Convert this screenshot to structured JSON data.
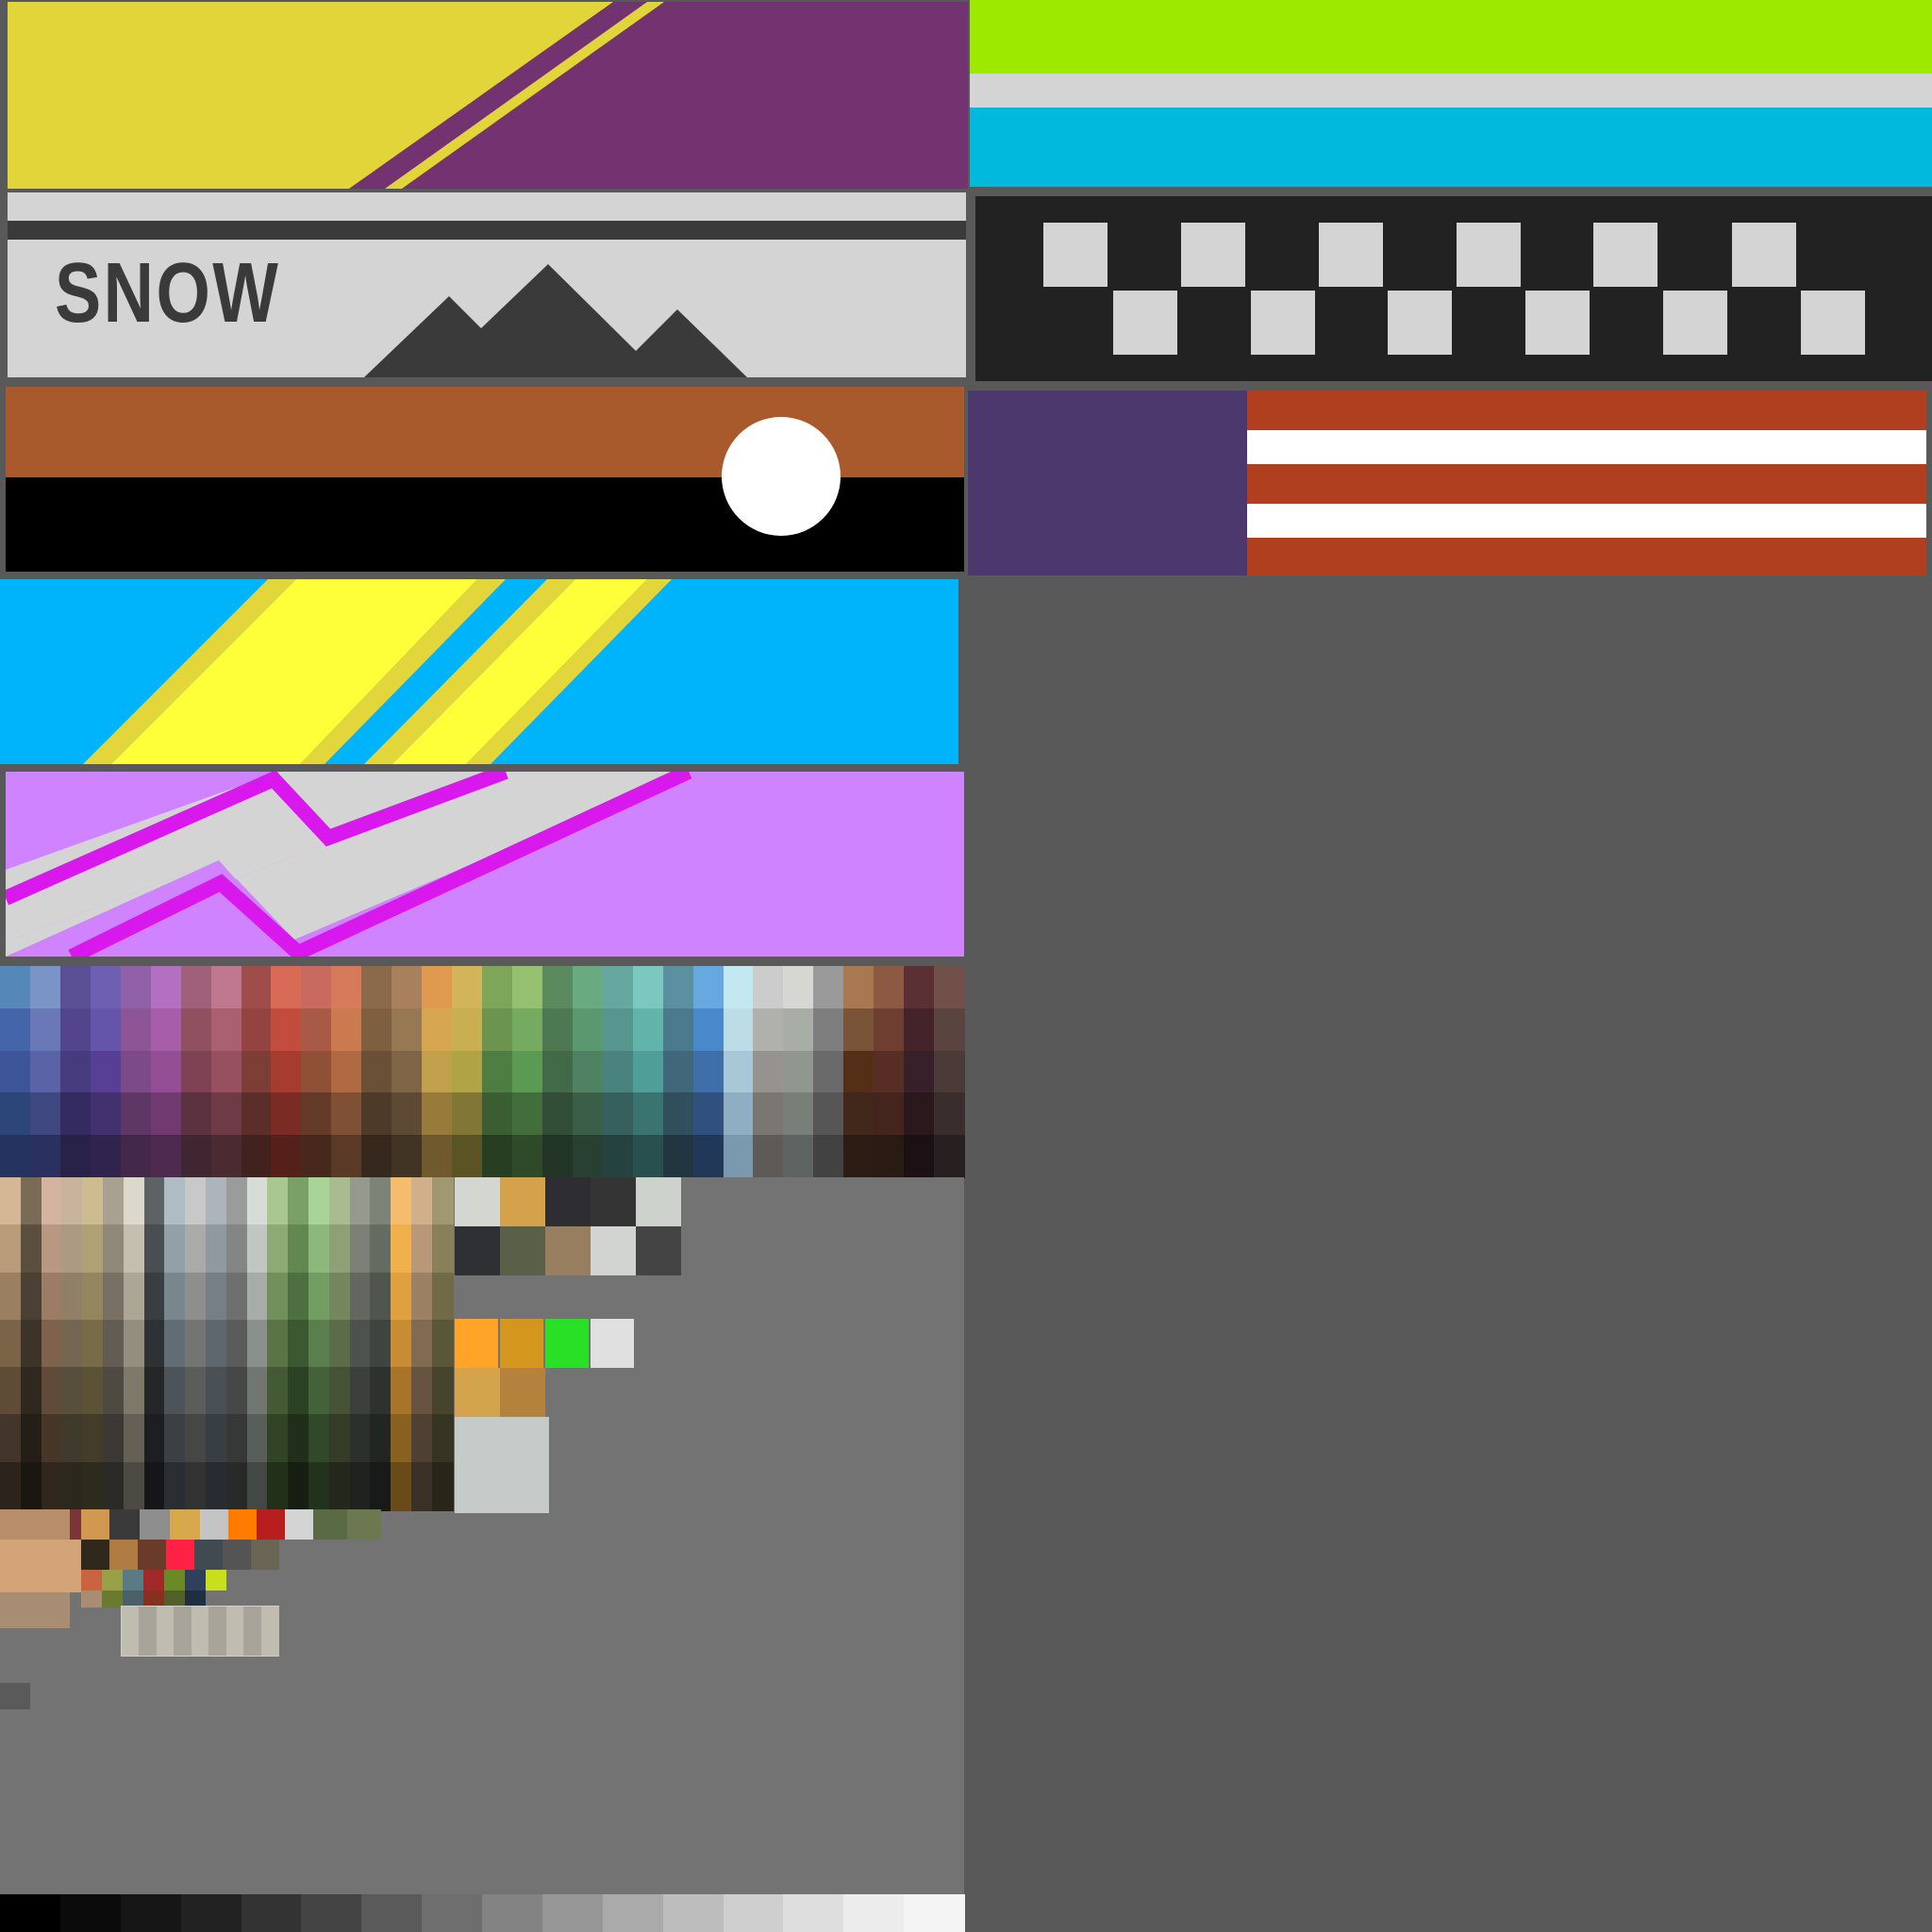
{
  "snow_panel": {
    "label": "SNOW"
  },
  "colors": {
    "background": "#595959",
    "palette_background": "#737373",
    "yellow": "#e2d53a",
    "purple": "#733370",
    "lime": "#9de900",
    "light_grey": "#d4d4d4",
    "cyan": "#00b9dc",
    "dark": "#222222",
    "snow_grey": "#d4d4d4",
    "mountain": "#3a3a3a",
    "rust": "#a85a2c",
    "black": "#000000",
    "white": "#ffffff",
    "flag_purple": "#4c386c",
    "flag_red": "#b03f20",
    "sky_blue": "#00b4fc",
    "bright_yellow": "#ffff39",
    "stripe_yellow": "#e3d63b",
    "lilac": "#d083ff",
    "magenta": "#d818ec"
  },
  "palette": {
    "top_columns": [
      [
        "#5587b9",
        "#4465a9",
        "#3b5596",
        "#2c4679",
        "#243360"
      ],
      [
        "#7a94c8",
        "#6b78b8",
        "#5a63a5",
        "#3e4780",
        "#2a3160"
      ],
      [
        "#5a4f94",
        "#54448e",
        "#463b7d",
        "#342c61",
        "#282148"
      ],
      [
        "#6e5fb2",
        "#6455aa",
        "#573f95",
        "#43306f",
        "#30244f"
      ],
      [
        "#9161a7",
        "#8e5596",
        "#7b4a87",
        "#5f3766",
        "#43284a"
      ],
      [
        "#b36fc2",
        "#a75daa",
        "#934e94",
        "#703a70",
        "#4e2a4e"
      ],
      [
        "#a0607a",
        "#915060",
        "#7e4254",
        "#5c3240",
        "#402630"
      ],
      [
        "#c07890",
        "#aa6070",
        "#965060",
        "#6e3a46",
        "#4c2a32"
      ],
      [
        "#9f4d4a",
        "#944440",
        "#7e3e38",
        "#5c2e2a",
        "#42221e"
      ],
      [
        "#d96a55",
        "#c24d3e",
        "#a63b30",
        "#7a2c24",
        "#56201a"
      ],
      [
        "#c86a60",
        "#a85a46",
        "#8f5038",
        "#643a28",
        "#46281c"
      ],
      [
        "#d67a5a",
        "#cb7a50",
        "#b06a42",
        "#805034",
        "#5a3a26"
      ],
      [
        "#8a6a4a",
        "#7e6040",
        "#6a5036",
        "#4e3a28",
        "#36281c"
      ],
      [
        "#a8805e",
        "#967855",
        "#806446",
        "#5e4a34",
        "#423424"
      ],
      [
        "#e09a50",
        "#d6a550",
        "#c0a04a",
        "#987a3a",
        "#6e5a2c"
      ],
      [
        "#d4b45a",
        "#c8b050",
        "#aea446",
        "#827636",
        "#5a5424"
      ],
      [
        "#7ea65a",
        "#6a9450",
        "#4e7e42",
        "#3a5e32",
        "#283e22"
      ],
      [
        "#94c070",
        "#74ab60",
        "#5a9a52",
        "#426e3c",
        "#2e4a28"
      ],
      [
        "#5a8a5e",
        "#4e7852",
        "#426a48",
        "#324e36",
        "#223426"
      ],
      [
        "#6aaa80",
        "#5a9870",
        "#4e8262",
        "#3a5e48",
        "#284032"
      ],
      [
        "#66a8a0",
        "#56968e",
        "#4a8280",
        "#36605e",
        "#264240"
      ],
      [
        "#7ac8c0",
        "#60b4aa",
        "#509e98",
        "#3a7470",
        "#28504e"
      ],
      [
        "#5a90a0",
        "#4a7a8c",
        "#40687a",
        "#304e5c",
        "#223642"
      ],
      [
        "#66a8e0",
        "#4a88cc",
        "#406ea8",
        "#30507e",
        "#223858"
      ],
      [
        "#c4e8f2",
        "#bcdce6",
        "#a8c8d8",
        "#90aec2",
        "#7a98ae"
      ],
      [
        "#cccccc",
        "#b0b0ac",
        "#969290",
        "#7a7672",
        "#5e5a58"
      ],
      [
        "#d6d6d2",
        "#a8aea6",
        "#909690",
        "#787e78",
        "#5e6462"
      ],
      [
        "#9a9a9a",
        "#7e7e7e",
        "#6a6a6a",
        "#565656",
        "#424242"
      ],
      [
        "#a87850",
        "#7a5438",
        "#542e16",
        "#42281a",
        "#2c1c14"
      ],
      [
        "#8c5a42",
        "#6e3e30",
        "#582e24",
        "#44241c",
        "#2a1a14"
      ],
      [
        "#5a3034",
        "#44242a",
        "#38202a",
        "#2a181c",
        "#1c1014"
      ],
      [
        "#705048",
        "#5a4440",
        "#4a3a38",
        "#3a2e2c",
        "#282020"
      ]
    ],
    "mid_columns": [
      [
        "#d4b896",
        "#b89c7a",
        "#9a8060",
        "#7a6448",
        "#5e4c36",
        "#42362a",
        "#2c241c"
      ],
      [
        "#7a6a56",
        "#5a4e3e",
        "#4a4034",
        "#3c3428",
        "#30281e",
        "#241e16",
        "#1a1610"
      ],
      [
        "#d4b4a0",
        "#b89880",
        "#9c7c64",
        "#7e624c",
        "#604a38",
        "#463628",
        "#30261c"
      ],
      [
        "#c8b49c",
        "#ac9a82",
        "#908068",
        "#746650",
        "#584e3c",
        "#403a2c",
        "#2c281e"
      ],
      [
        "#ccbc90",
        "#b0a076",
        "#94865e",
        "#786c48",
        "#5c5236",
        "#423c28",
        "#2e2a1c"
      ],
      [
        "#a8a090",
        "#908878",
        "#787064",
        "#625c52",
        "#4e4a42",
        "#3c3834",
        "#2c2a26"
      ],
      [
        "#dcd8cc",
        "#c4beb0",
        "#aca696",
        "#948e80",
        "#7c786a",
        "#646056",
        "#4c4a42"
      ],
      [
        "#5e6264",
        "#4a4e50",
        "#3a3e40",
        "#2e3234",
        "#242628",
        "#1c1e20",
        "#141618"
      ],
      [
        "#b0bcc4",
        "#94a0a8",
        "#7a868e",
        "#626c74",
        "#4c545a",
        "#3a4044",
        "#2a2e32"
      ],
      [
        "#c8c8c8",
        "#aaaaa8",
        "#8e8e8c",
        "#747472",
        "#5c5c5a",
        "#464644",
        "#323232"
      ],
      [
        "#aeb4bc",
        "#9098a0",
        "#767e86",
        "#5e666e",
        "#4a5056",
        "#383e42",
        "#282c30"
      ],
      [
        "#9a9c9c",
        "#848686",
        "#6e7070",
        "#5a5c5c",
        "#464848",
        "#363838",
        "#282a2a"
      ],
      [
        "#d8dcd8",
        "#c2c6c2",
        "#a8aca8",
        "#8c908c",
        "#727672",
        "#5a5e5a",
        "#444844"
      ],
      [
        "#a8c890",
        "#8eaa74",
        "#72905c",
        "#5a7446",
        "#445a34",
        "#324426",
        "#22301a"
      ],
      [
        "#7aa066",
        "#628850",
        "#4e7040",
        "#3c5830",
        "#2c4224",
        "#202e1a",
        "#161e12"
      ],
      [
        "#a8d498",
        "#8cb87c",
        "#729e64",
        "#5a7e4e",
        "#44623a",
        "#32482a",
        "#22321c"
      ],
      [
        "#a8bc90",
        "#8ea076",
        "#74865e",
        "#5c6c48",
        "#465236",
        "#343c28",
        "#24281c"
      ],
      [
        "#949a8e",
        "#7a8076",
        "#626860",
        "#4e524c",
        "#3c403a",
        "#2c302c",
        "#202220"
      ],
      [
        "#7c8478",
        "#646c62",
        "#50564e",
        "#3e443e",
        "#2e322e",
        "#222622",
        "#181a18"
      ],
      [
        "#f4bc6c",
        "#f0b04c",
        "#e0a040",
        "#c88c34",
        "#a8742a",
        "#886020",
        "#6a4a18"
      ],
      [
        "#d0b08c",
        "#b89878",
        "#9c8064",
        "#806a52",
        "#665440",
        "#4e4032",
        "#3a3026"
      ],
      [
        "#a09870",
        "#888058",
        "#706a46",
        "#5a5638",
        "#46442c",
        "#363422",
        "#282618"
      ]
    ],
    "mid_grid": [
      {
        "c": "#d4d6d0",
        "col": 0,
        "row": 0
      },
      {
        "c": "#d4a24a",
        "col": 1,
        "row": 0
      },
      {
        "c": "#2e2e32",
        "col": 2,
        "row": 0
      },
      {
        "c": "#343434",
        "col": 3,
        "row": 0
      },
      {
        "c": "#cdd2cd",
        "col": 4,
        "row": 0
      },
      {
        "c": "#2e3034",
        "col": 0,
        "row": 1
      },
      {
        "c": "#5a6048",
        "col": 1,
        "row": 1
      },
      {
        "c": "#967e5e",
        "col": 2,
        "row": 1
      },
      {
        "c": "#d2d4d2",
        "col": 3,
        "row": 1
      },
      {
        "c": "#444444",
        "col": 4,
        "row": 1
      }
    ],
    "accent_row": [
      "#ffa426",
      "#d4961c",
      "#29e027",
      "#e0e0e0"
    ],
    "accent_row2": [
      "#d4a44c",
      "#b4823c"
    ],
    "large_swatch": "#c6cbc9",
    "small_row1": [
      "#b88d6a",
      "#7a3636",
      "#d09850",
      "#3a3a3a",
      "#8e8e8e",
      "#d8a84c",
      "#c4c4c4",
      "#ff7c00",
      "#b81e1e",
      "#d4d4d4",
      "#5a6a44",
      "#6c7850"
    ],
    "small_row2": [
      "#d4a479",
      "#30281a",
      "#b07c44",
      "#6a3a2a",
      "#ff2244",
      "#404a52",
      "#545454",
      "#6a6454"
    ],
    "small_row3": [
      "#c86440",
      "#98a048",
      "#5a7a86",
      "#a02a2a",
      "#6a8a28",
      "#30405a",
      "#c8e01c"
    ],
    "small_row4": [
      "#a88d72",
      "#6c7a30",
      "#4a6068",
      "#883020",
      "#506028",
      "#1e3040"
    ],
    "film_strip": [
      "#c0bcb0",
      "#a8a49a",
      "#c0bcb0",
      "#a8a49a",
      "#c0bcb0",
      "#a8a49a",
      "#c0bcb0",
      "#a8a49a",
      "#c0bcb0"
    ],
    "tiny_swatch": "#5a5a5a",
    "grayscale": [
      "#000000",
      "#0b0b0b",
      "#161616",
      "#222222",
      "#333333",
      "#444444",
      "#5a5a5a",
      "#6e6e6e",
      "#838383",
      "#969696",
      "#aaaaaa",
      "#bdbdbd",
      "#cfcfcf",
      "#dedede",
      "#ececec",
      "#f4f4f4"
    ]
  }
}
